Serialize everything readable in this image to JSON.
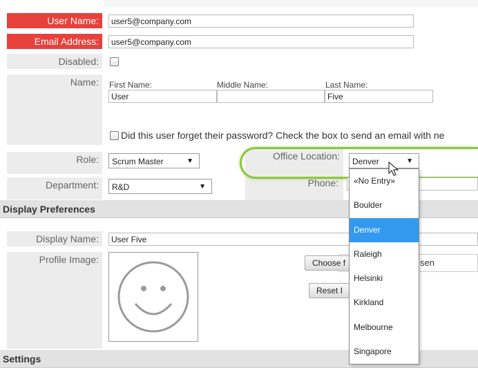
{
  "form": {
    "user_name": {
      "label": "User Name:",
      "value": "user5@company.com"
    },
    "email": {
      "label": "Email Address:",
      "value": "user5@company.com"
    },
    "disabled": {
      "label": "Disabled:"
    },
    "name": {
      "label": "Name:",
      "first_label": "First Name:",
      "first_value": "User",
      "middle_label": "Middle Name:",
      "middle_value": "",
      "last_label": "Last Name:",
      "last_value": "Five"
    },
    "forgot_password_text": "Did this user forget their password? Check the box to send an email with ne",
    "role": {
      "label": "Role:",
      "value": "Scrum Master"
    },
    "office_location": {
      "label": "Office Location:",
      "value": "Denver"
    },
    "department": {
      "label": "Department:",
      "value": "R&D"
    },
    "phone": {
      "label": "Phone:"
    }
  },
  "office_location_options": [
    {
      "label": "«No Entry»",
      "selected": false
    },
    {
      "label": "Boulder",
      "selected": false
    },
    {
      "label": "Denver",
      "selected": true
    },
    {
      "label": "Raleigh",
      "selected": false
    },
    {
      "label": "Helsinki",
      "selected": false
    },
    {
      "label": "Kirkland",
      "selected": false
    },
    {
      "label": "Melbourne",
      "selected": false
    },
    {
      "label": "Singapore",
      "selected": false
    }
  ],
  "display_preferences": {
    "header": "Display Preferences",
    "display_name": {
      "label": "Display Name:",
      "value": "User Five"
    },
    "profile_image": {
      "label": "Profile Image:"
    },
    "choose_button": "Choose f",
    "file_status_fragment": "sen",
    "reset_button": "Reset I"
  },
  "settings": {
    "header": "Settings"
  },
  "colors": {
    "required_label_bg": "#e8403a",
    "highlight_ring": "#8cc63f",
    "selected_option": "#3399ee"
  },
  "icons": {
    "profile_placeholder": "smiley-face-icon",
    "cursor": "mouse-pointer-icon",
    "select_arrow": "triangle-down-icon"
  }
}
